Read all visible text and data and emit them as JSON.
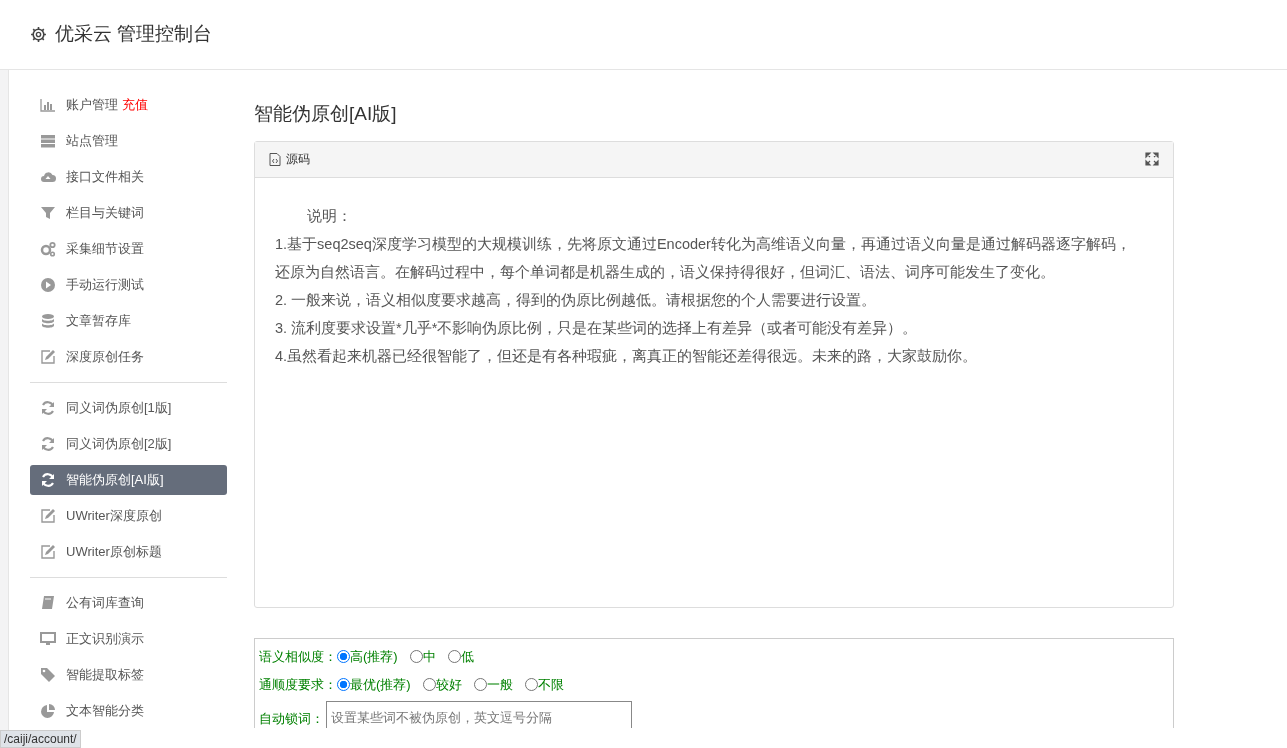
{
  "header": {
    "title": "优采云 管理控制台"
  },
  "sidebar": {
    "groups": [
      {
        "items": [
          {
            "kind": "bar-chart",
            "label": "账户管理",
            "badge": "充值",
            "selected": false
          },
          {
            "kind": "server",
            "label": "站点管理",
            "selected": false
          },
          {
            "kind": "cloud",
            "label": "接口文件相关",
            "selected": false
          },
          {
            "kind": "filter",
            "label": "栏目与关键词",
            "selected": false
          },
          {
            "kind": "gears",
            "label": "采集细节设置",
            "selected": false
          },
          {
            "kind": "play",
            "label": "手动运行测试",
            "selected": false
          },
          {
            "kind": "database",
            "label": "文章暂存库",
            "selected": false
          },
          {
            "kind": "edit",
            "label": "深度原创任务",
            "selected": false
          }
        ]
      },
      {
        "items": [
          {
            "kind": "refresh",
            "label": "同义词伪原创[1版]",
            "selected": false
          },
          {
            "kind": "refresh",
            "label": "同义词伪原创[2版]",
            "selected": false
          },
          {
            "kind": "refresh",
            "label": "智能伪原创[AI版]",
            "selected": true
          },
          {
            "kind": "edit",
            "label": "UWriter深度原创",
            "selected": false
          },
          {
            "kind": "edit",
            "label": "UWriter原创标题",
            "selected": false
          }
        ]
      },
      {
        "items": [
          {
            "kind": "book",
            "label": "公有词库查询",
            "selected": false
          },
          {
            "kind": "monitor",
            "label": "正文识别演示",
            "selected": false
          },
          {
            "kind": "tag",
            "label": "智能提取标签",
            "selected": false
          },
          {
            "kind": "pie",
            "label": "文本智能分类",
            "selected": false
          }
        ]
      }
    ]
  },
  "page_title": "智能伪原创[AI版]",
  "editor": {
    "toolbar_button": "源码",
    "heading": "说明：",
    "paragraphs": [
      "1.基于seq2seq深度学习模型的大规模训练，先将原文通过Encoder转化为高维语义向量，再通过语义向量是通过解码器逐字解码，还原为自然语言。在解码过程中，每个单词都是机器生成的，语义保持得很好，但词汇、语法、词序可能发生了变化。",
      "2. 一般来说，语义相似度要求越高，得到的伪原比例越低。请根据您的个人需要进行设置。",
      "3. 流利度要求设置*几乎*不影响伪原比例，只是在某些词的选择上有差异（或者可能没有差异）。",
      "4.虽然看起来机器已经很智能了，但还是有各种瑕疵，离真正的智能还差得很远。未来的路，大家鼓励你。"
    ]
  },
  "form": {
    "similarity": {
      "label": "语义相似度：",
      "options": [
        {
          "label": "高(推荐)",
          "selected": true
        },
        {
          "label": "中",
          "selected": false
        },
        {
          "label": "低",
          "selected": false
        }
      ]
    },
    "fluency": {
      "label": "通顺度要求：",
      "options": [
        {
          "label": "最优(推荐)",
          "selected": true
        },
        {
          "label": "较好",
          "selected": false
        },
        {
          "label": "一般",
          "selected": false
        },
        {
          "label": "不限",
          "selected": false
        }
      ]
    },
    "lock_words": {
      "label": "自动锁词：",
      "placeholder": "设置某些词不被伪原创，英文逗号分隔"
    }
  },
  "status_bar": {
    "url": "/caiji/account/"
  }
}
